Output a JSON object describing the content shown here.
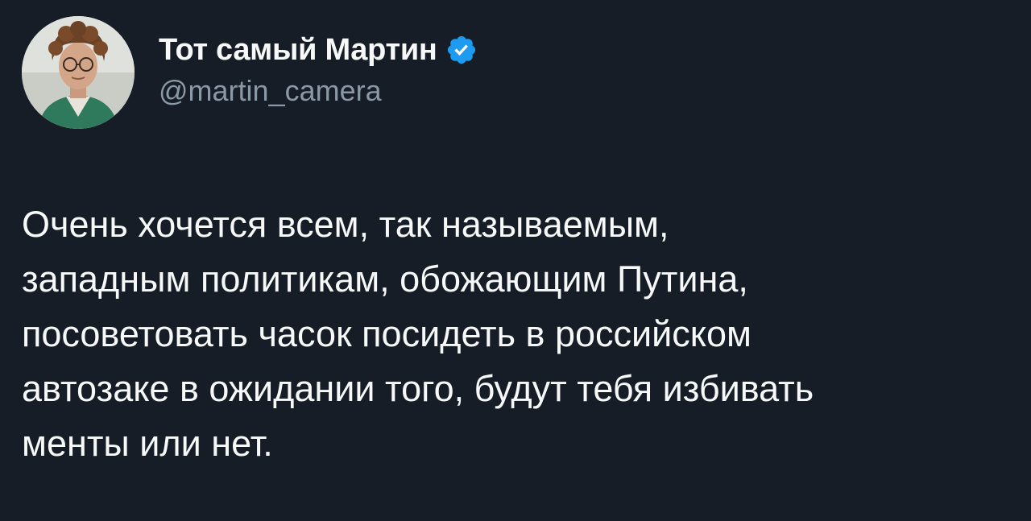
{
  "tweet": {
    "author": {
      "display_name": "Тот самый Мартин",
      "handle": "@martin_camera",
      "verified": true,
      "avatar_icon": "profile-photo",
      "verified_icon": "verified-badge-icon"
    },
    "text": "Очень хочется всем, так называемым,\nзападным политикам, обожающим Путина,\nпосоветовать часок посидеть в российском\nавтозаке в ожидании того, будут тебя избивать\nменты или нет."
  },
  "colors": {
    "background": "#161d27",
    "primary_text": "#f7f9f9",
    "secondary_text": "#8b98a5",
    "verified_blue": "#1d9bf0"
  }
}
